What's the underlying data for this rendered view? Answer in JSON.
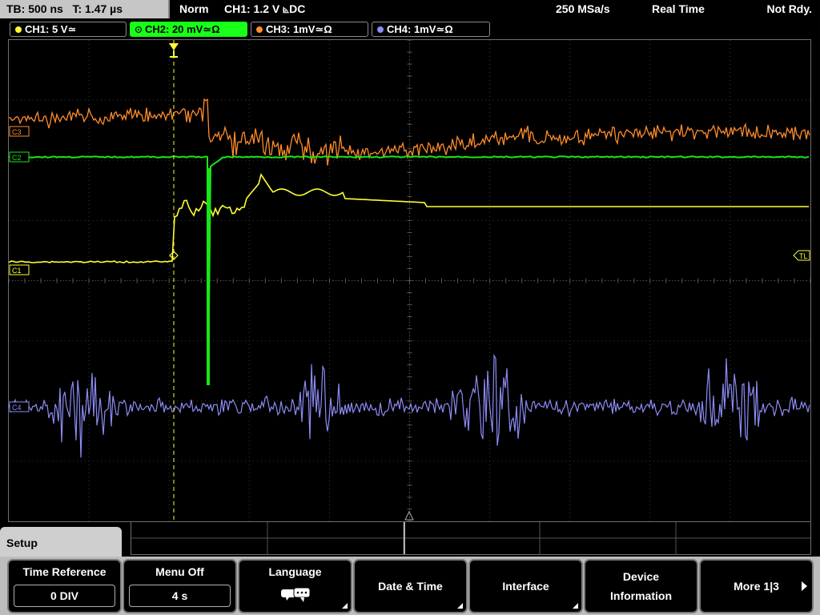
{
  "header": {
    "timebase": "TB: 500 ns",
    "trigger_time": "T: 1.47 µs",
    "acq_mode": "Norm",
    "trigger_info": "CH1: 1.2 V ⦝DC",
    "sample_rate": "250 MSa/s",
    "run_mode": "Real Time",
    "status": "Not Rdy."
  },
  "channels": [
    {
      "label": "CH1: 5 V≃",
      "color": "#ffff33"
    },
    {
      "label": "CH2: 20 mV≃Ω",
      "color": "#19e619",
      "active": true
    },
    {
      "label": "CH3: 1mV≃Ω",
      "color": "#ff8c2a"
    },
    {
      "label": "CH4: 1mV≃Ω",
      "color": "#8c8cf5"
    }
  ],
  "markers": {
    "ch1": "C1",
    "ch2": "C2",
    "ch3": "C3",
    "ch4": "C4",
    "trigger_level": "TL",
    "trigger_point": "T"
  },
  "menu": {
    "tab": "Setup",
    "softkeys": [
      {
        "title": "Time Reference",
        "value": "0 DIV"
      },
      {
        "title": "Menu Off",
        "value": "4 s"
      },
      {
        "title": "Language"
      },
      {
        "title": "Date & Time"
      },
      {
        "title": "Interface"
      },
      {
        "title": "Device Information"
      },
      {
        "title": "More 1|3"
      }
    ]
  },
  "icons": {
    "language": "speech-bubbles-icon",
    "more": "arrow-right-icon",
    "submenu": "submenu-corner-icon"
  }
}
